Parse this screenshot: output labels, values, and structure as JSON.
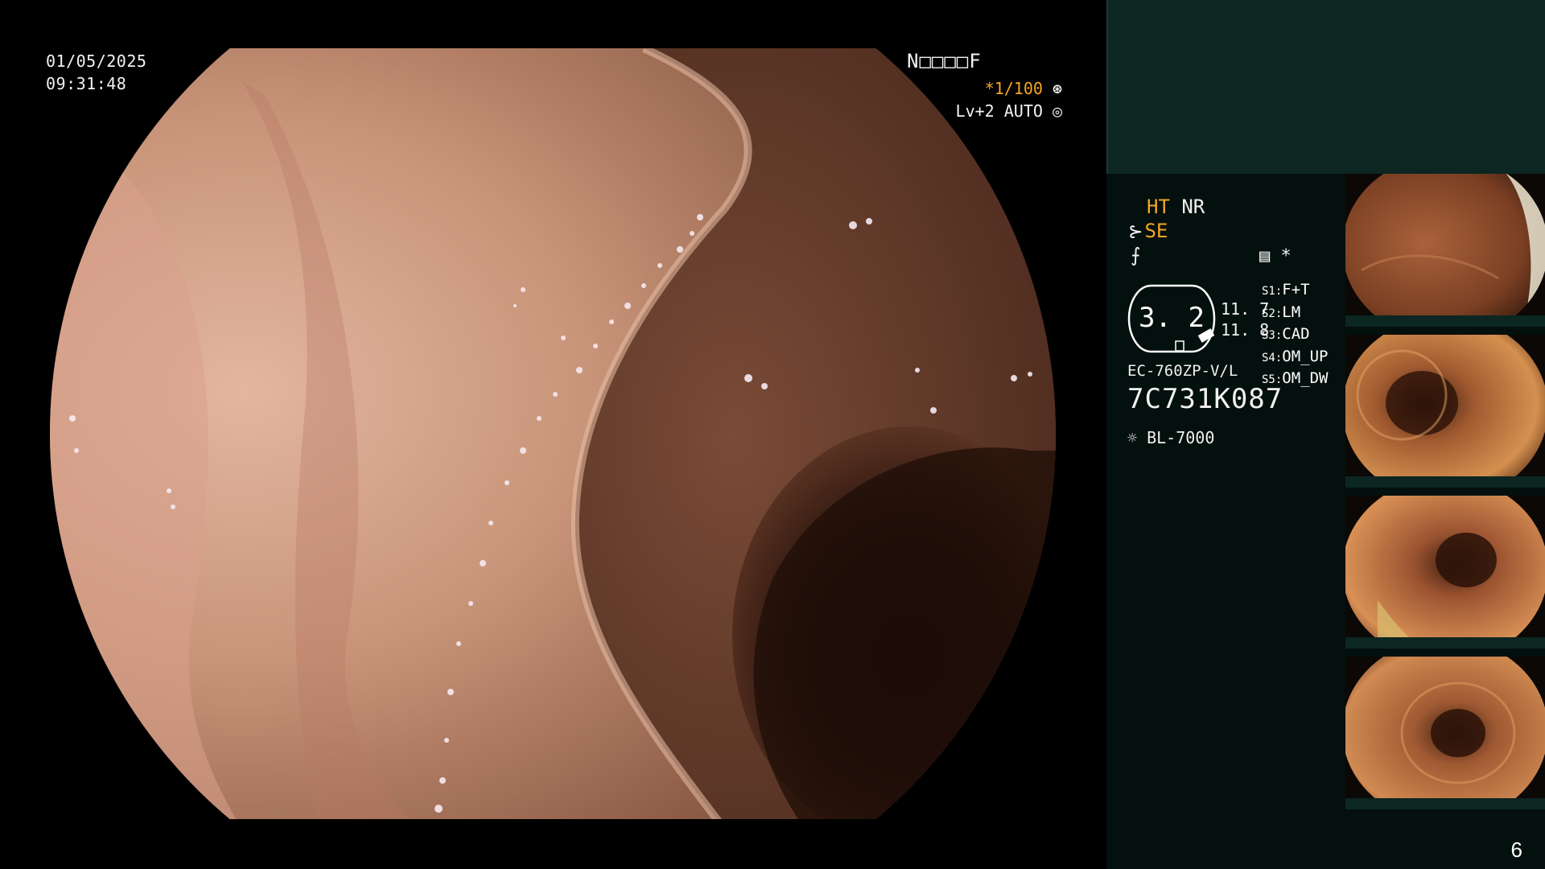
{
  "overlay": {
    "date": "01/05/2025",
    "time": "09:31:48",
    "code": "N□□□□F",
    "shutter_prefix": "*1/100",
    "shutter_icon": "aperture-icon",
    "level": "Lv+2 AUTO",
    "level_icon": "iris-icon"
  },
  "panel": {
    "ht": "HT",
    "nr": "NR",
    "se": "SE",
    "se_icon": "enhance-icon",
    "filter_icon": "freeze-icon",
    "memo_icon": "memory-icon",
    "memo_mark": "*",
    "ring_value": "3. 2",
    "value1": "11. 7",
    "value2": "11. 8",
    "settings": [
      {
        "key": "S1:",
        "val": "F+T"
      },
      {
        "key": "S2:",
        "val": "LM"
      },
      {
        "key": "S3:",
        "val": "CAD"
      },
      {
        "key": "S4:",
        "val": "OM_UP"
      },
      {
        "key": "S5:",
        "val": "OM_DW"
      }
    ],
    "model": "EC-760ZP-V/L",
    "serial": "7C731K087",
    "lamp_icon": "light-source-icon",
    "lamp": "BL-7000",
    "accent": "#f5a623",
    "panel_top_color": "#0c2622",
    "panel_color": "#04100e"
  },
  "thumbnails": [
    {
      "name": "thumbnail-1"
    },
    {
      "name": "thumbnail-2"
    },
    {
      "name": "thumbnail-3"
    },
    {
      "name": "thumbnail-4"
    }
  ],
  "page_number": "6"
}
